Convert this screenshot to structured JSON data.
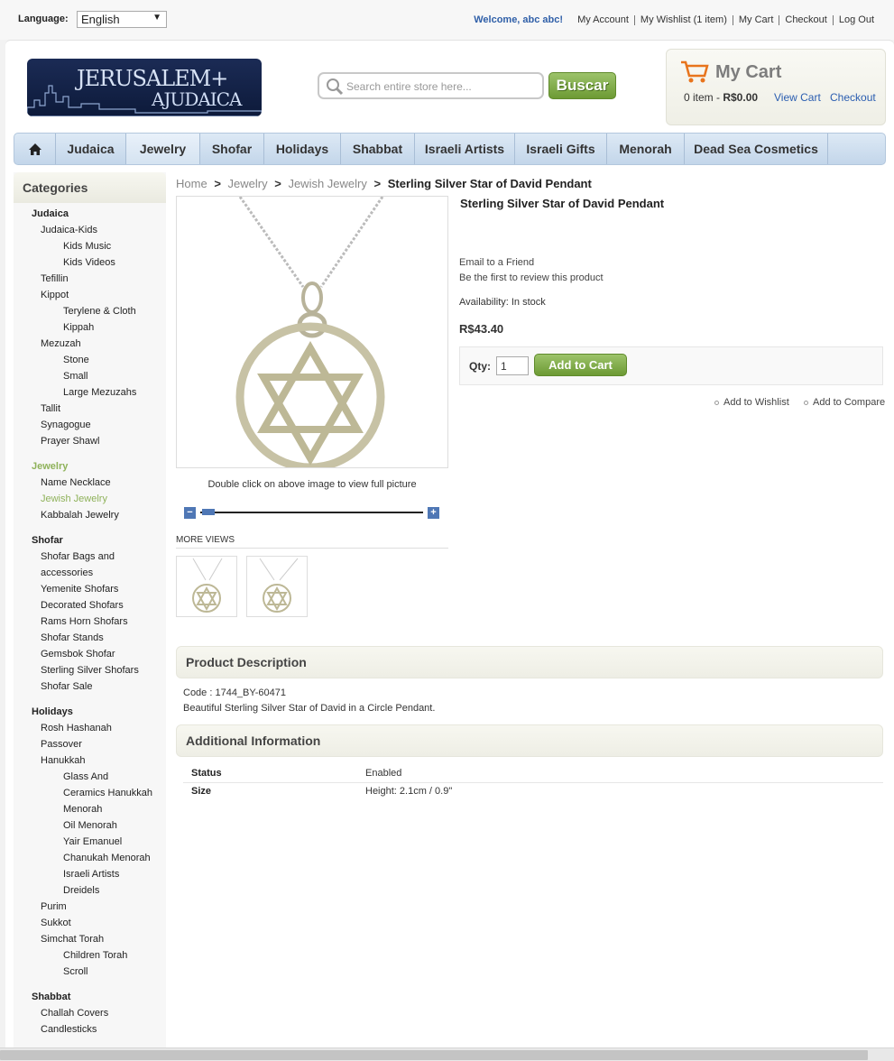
{
  "topbar": {
    "language_label": "Language:",
    "language_value": "English",
    "welcome": "Welcome, abc abc!",
    "links": [
      "My Account",
      "My Wishlist (1 item)",
      "My Cart",
      "Checkout",
      "Log Out"
    ]
  },
  "search": {
    "placeholder": "Search entire store here...",
    "button": "Buscar"
  },
  "cart": {
    "title": "My Cart",
    "count": "0 item - ",
    "total": "R$0.00",
    "view_cart": "View Cart",
    "checkout": "Checkout"
  },
  "nav": [
    "Judaica",
    "Jewelry",
    "Shofar",
    "Holidays",
    "Shabbat",
    "Israeli Artists",
    "Israeli Gifts",
    "Menorah",
    "Dead Sea Cosmetics"
  ],
  "sidebar": {
    "title": "Categories",
    "items": [
      {
        "label": "Judaica",
        "level": 0
      },
      {
        "label": "Judaica-Kids",
        "level": 1
      },
      {
        "label": "Kids Music",
        "level": 2
      },
      {
        "label": "Kids Videos",
        "level": 2
      },
      {
        "label": "Tefillin",
        "level": 1
      },
      {
        "label": "Kippot",
        "level": 1
      },
      {
        "label": "Terylene & Cloth",
        "level": 2
      },
      {
        "label": "Kippah",
        "level": 2
      },
      {
        "label": "Mezuzah",
        "level": 1
      },
      {
        "label": "Stone",
        "level": 2
      },
      {
        "label": "Small",
        "level": 2
      },
      {
        "label": "Large Mezuzahs",
        "level": 2
      },
      {
        "label": "Tallit",
        "level": 1
      },
      {
        "label": "Synagogue",
        "level": 1
      },
      {
        "label": "Prayer Shawl",
        "level": 1
      },
      {
        "label": "Jewelry",
        "level": 0,
        "active": true
      },
      {
        "label": "Name Necklace",
        "level": 1
      },
      {
        "label": "Jewish Jewelry",
        "level": 1,
        "active": true
      },
      {
        "label": "Kabbalah Jewelry",
        "level": 1
      },
      {
        "label": "Shofar",
        "level": 0
      },
      {
        "label": "Shofar Bags and",
        "level": 1
      },
      {
        "label": "accessories",
        "level": 1
      },
      {
        "label": "Yemenite Shofars",
        "level": 1
      },
      {
        "label": "Decorated Shofars",
        "level": 1
      },
      {
        "label": "Rams Horn Shofars",
        "level": 1
      },
      {
        "label": "Shofar Stands",
        "level": 1
      },
      {
        "label": "Gemsbok Shofar",
        "level": 1
      },
      {
        "label": "Sterling Silver Shofars",
        "level": 1
      },
      {
        "label": "Shofar Sale",
        "level": 1
      },
      {
        "label": "Holidays",
        "level": 0
      },
      {
        "label": "Rosh Hashanah",
        "level": 1
      },
      {
        "label": "Passover",
        "level": 1
      },
      {
        "label": "Hanukkah",
        "level": 1
      },
      {
        "label": "Glass And",
        "level": 2
      },
      {
        "label": "Ceramics Hanukkah",
        "level": 2
      },
      {
        "label": "Menorah",
        "level": 2
      },
      {
        "label": "Oil Menorah",
        "level": 2
      },
      {
        "label": "Yair Emanuel",
        "level": 2
      },
      {
        "label": "Chanukah Menorah",
        "level": 2
      },
      {
        "label": "Israeli Artists",
        "level": 2
      },
      {
        "label": "Dreidels",
        "level": 2
      },
      {
        "label": "Purim",
        "level": 1
      },
      {
        "label": "Sukkot",
        "level": 1
      },
      {
        "label": "Simchat Torah",
        "level": 1
      },
      {
        "label": "Children Torah",
        "level": 2
      },
      {
        "label": "Scroll",
        "level": 2
      },
      {
        "label": "Shabbat",
        "level": 0
      },
      {
        "label": "Challah Covers",
        "level": 1
      },
      {
        "label": "Candlesticks",
        "level": 1
      }
    ]
  },
  "breadcrumb": {
    "home": "Home",
    "c1": "Jewelry",
    "c2": "Jewish Jewelry",
    "current": "Sterling Silver Star of David Pendant",
    "sep": ">"
  },
  "product": {
    "title": "Sterling Silver Star of David Pendant",
    "email": "Email to a Friend",
    "review": "Be the first to review this product",
    "availability": "Availability: In stock",
    "price": "R$43.40",
    "qty_label": "Qty:",
    "qty_value": "1",
    "add_to_cart": "Add to Cart",
    "wishlist": "Add to Wishlist",
    "compare": "Add to Compare",
    "image_hint": "Double click on above image to view full picture",
    "more_views": "MORE VIEWS"
  },
  "description": {
    "title": "Product Description",
    "code": "Code : 1744_BY-60471",
    "text": "Beautiful Sterling Silver Star of David in a Circle Pendant."
  },
  "additional": {
    "title": "Additional Information",
    "rows": [
      {
        "k": "Status",
        "v": "Enabled"
      },
      {
        "k": "Size",
        "v": "Height: 2.1cm / 0.9\""
      }
    ]
  },
  "colors": {
    "accent_green": "#7ba840",
    "link_blue": "#2a5db0",
    "nav_blue": "#c3d6ea"
  },
  "icons": [
    "home-icon",
    "search-icon",
    "cart-icon",
    "zoom-out-icon",
    "zoom-in-icon"
  ]
}
